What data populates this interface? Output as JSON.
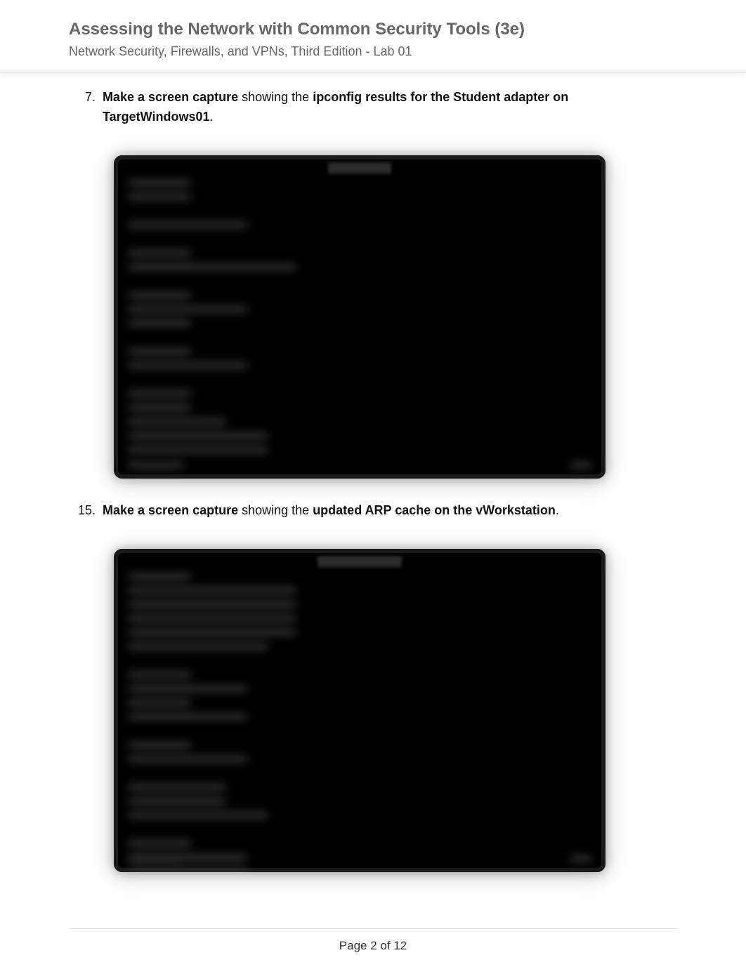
{
  "header": {
    "title": "Assessing the Network with Common Security Tools (3e)",
    "subtitle": "Network Security, Firewalls, and VPNs, Third Edition - Lab 01"
  },
  "items": [
    {
      "num": "7.",
      "bold_a": "Make a screen capture",
      "mid": " showing the ",
      "bold_b": "ipconfig results for the Student adapter on TargetWindows01",
      "end": "."
    },
    {
      "num": "15.",
      "bold_a": "Make a screen capture",
      "mid": " showing the ",
      "bold_b": "updated ARP cache on the vWorkstation",
      "end": "."
    }
  ],
  "footer": {
    "page_label": "Page 2 of 12"
  }
}
